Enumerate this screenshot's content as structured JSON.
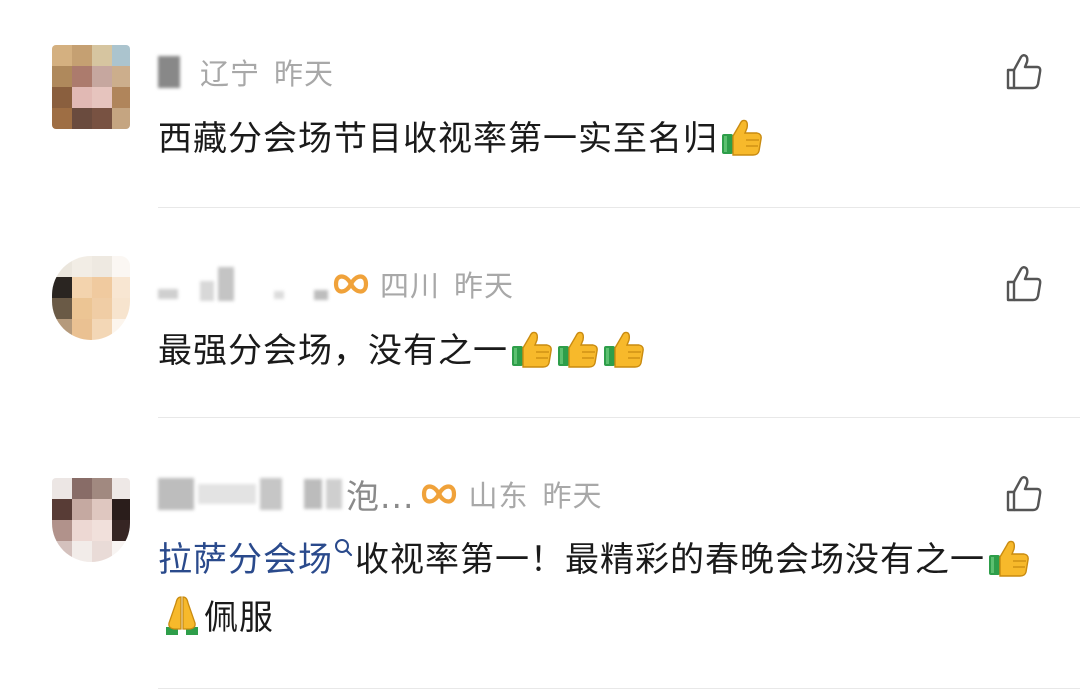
{
  "comments": [
    {
      "username_visible": "",
      "location": "辽宁",
      "time": "昨天",
      "text": "西藏分会场节目收视率第一实至名归",
      "emojis": [
        "thumbs-up"
      ]
    },
    {
      "username_visible": "",
      "location": "四川",
      "time": "昨天",
      "text": "最强分会场，没有之一",
      "emojis": [
        "thumbs-up",
        "thumbs-up",
        "thumbs-up"
      ]
    },
    {
      "username_visible": "泡...",
      "location": "山东",
      "time": "昨天",
      "topic": "拉萨分会场",
      "text": "收视率第一！最精彩的春晚会场没有之一",
      "after_emoji_text": "佩服",
      "emojis": [
        "thumbs-up",
        "folded-hands"
      ]
    }
  ],
  "colors": {
    "meta_gray": "#a8a8a8",
    "text": "#1a1a1a",
    "topic_blue": "#2a4a8c",
    "badge_orange": "#f0a23a",
    "divider": "#e8e8e8"
  },
  "icons": {
    "like": "thumbs-up-outline-icon",
    "badge": "infinity-badge-icon",
    "topic_search": "search-icon"
  }
}
